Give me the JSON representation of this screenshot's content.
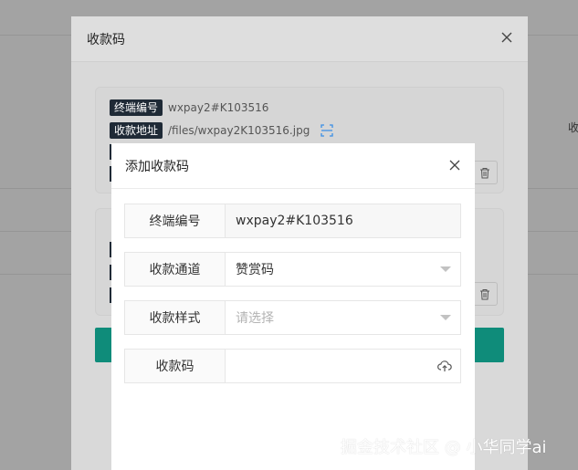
{
  "outer_dialog": {
    "title": "收款码",
    "cards": [
      {
        "terminal_tag": "终端编号",
        "terminal_value": "wxpay2#K103516",
        "address_tag": "收款地址",
        "address_value": "/files/wxpay2K103516.jpg"
      }
    ]
  },
  "background": {
    "side_label": "收"
  },
  "inner_dialog": {
    "title": "添加收款码",
    "fields": [
      {
        "label": "终端编号",
        "value": "wxpay2#K103516",
        "placeholder": ""
      },
      {
        "label": "收款通道",
        "value": "赞赏码",
        "placeholder": ""
      },
      {
        "label": "收款样式",
        "value": "",
        "placeholder": "请选择"
      },
      {
        "label": "收款码",
        "value": "",
        "placeholder": ""
      }
    ]
  },
  "watermark": "掘金技术社区 @ 小华同学ai",
  "icons": [
    "close-icon",
    "scan-icon",
    "trash-icon",
    "chevron-down-icon",
    "upload-cloud-icon"
  ],
  "colors": {
    "tag_bg": "#1f2a36",
    "accent_teal": "#0f8c7a",
    "scan_icon": "#3a8ee6"
  }
}
